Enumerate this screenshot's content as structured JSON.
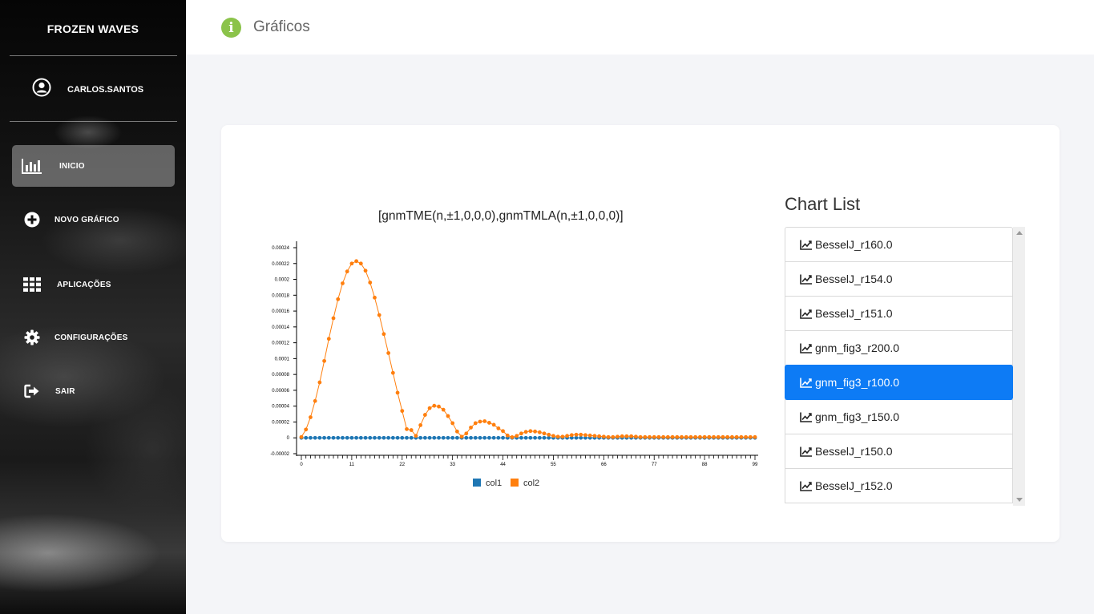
{
  "sidebar": {
    "brand": "FROZEN WAVES",
    "username": "CARLOS.SANTOS",
    "items": [
      {
        "label": "INICIO",
        "icon": "bar-chart-icon"
      },
      {
        "label": "NOVO GRÁFICO",
        "icon": "plus-circle-icon"
      },
      {
        "label": "APLICAÇÕES",
        "icon": "grid-icon"
      },
      {
        "label": "CONFIGURAÇÕES",
        "icon": "gear-icon"
      },
      {
        "label": "SAIR",
        "icon": "sign-out-icon"
      }
    ]
  },
  "header": {
    "title": "Gráficos",
    "icon": "info-icon"
  },
  "chart_list": {
    "title": "Chart List",
    "items": [
      {
        "label": "BesselJ_r160.0",
        "active": false
      },
      {
        "label": "BesselJ_r154.0",
        "active": false
      },
      {
        "label": "BesselJ_r151.0",
        "active": false
      },
      {
        "label": "gnm_fig3_r200.0",
        "active": false
      },
      {
        "label": "gnm_fig3_r100.0",
        "active": true
      },
      {
        "label": "gnm_fig3_r150.0",
        "active": false
      },
      {
        "label": "BesselJ_r150.0",
        "active": false
      },
      {
        "label": "BesselJ_r152.0",
        "active": false
      }
    ]
  },
  "colors": {
    "col1": "#1f77b4",
    "col2": "#ff7f0e",
    "active": "#0d7bf5",
    "info": "#8bc34a"
  },
  "chart_data": {
    "type": "line",
    "title": "[gnmTME(n,±1,0,0,0),gnmTMLA(n,±1,0,0,0)]",
    "xlabel": "",
    "ylabel": "",
    "xlim": [
      0,
      99
    ],
    "ylim": [
      -2e-05,
      0.00024
    ],
    "x_ticks": [
      0,
      11,
      22,
      33,
      44,
      55,
      66,
      77,
      88,
      99
    ],
    "y_ticks": [
      -2e-05,
      0,
      2e-05,
      4e-05,
      6e-05,
      8e-05,
      0.0001,
      0.00012,
      0.00014,
      0.00016,
      0.00018,
      0.0002,
      0.00022,
      0.00024
    ],
    "y_tick_labels": [
      "-0.00002",
      "0",
      "0.00002",
      "0.00004",
      "0.00006",
      "0.00008",
      "0.0001",
      "0.00012",
      "0.00014",
      "0.00016",
      "0.00018",
      "0.0002",
      "0.00022",
      "0.00024"
    ],
    "legend": "bottom",
    "series": [
      {
        "name": "col1",
        "values": [
          0,
          0,
          0,
          0,
          0,
          0,
          0,
          0,
          0,
          0,
          0,
          0,
          0,
          0,
          0,
          0,
          0,
          0,
          0,
          0,
          0,
          0,
          0,
          0,
          0,
          0,
          0,
          0,
          0,
          0,
          0,
          0,
          0,
          0,
          0,
          0,
          0,
          0,
          0,
          0,
          0,
          0,
          0,
          0,
          0,
          0,
          0,
          0,
          0,
          0,
          0,
          0,
          0,
          0,
          0,
          0,
          0,
          0,
          0,
          0,
          0,
          0,
          0,
          0,
          0,
          0,
          0,
          0,
          0,
          0,
          0,
          0,
          0,
          0,
          0,
          0,
          0,
          0,
          0,
          0,
          0,
          0,
          0,
          0,
          0,
          0,
          0,
          0,
          0,
          0,
          0,
          0,
          0,
          0,
          0,
          0,
          0,
          0,
          0,
          0
        ]
      },
      {
        "name": "col2",
        "values": [
          1e-06,
          1.05e-05,
          2.6e-05,
          4.65e-05,
          7e-05,
          9.7e-05,
          0.000125,
          0.000151,
          0.000175,
          0.000195,
          0.00021,
          0.00022,
          0.000223,
          0.00022,
          0.000211,
          0.000196,
          0.000177,
          0.000155,
          0.000131,
          0.000107,
          8.2e-05,
          5.7e-05,
          3.4e-05,
          1.1e-05,
          9.8e-06,
          2.5e-06,
          1.6e-05,
          2.9e-05,
          3.75e-05,
          4.05e-05,
          3.95e-05,
          3.55e-05,
          2.75e-05,
          1.85e-05,
          8e-06,
          1.5e-06,
          5.5e-06,
          1.3e-05,
          1.85e-05,
          2.05e-05,
          2.1e-05,
          1.9e-05,
          1.65e-05,
          1.2e-05,
          8.5e-06,
          3e-06,
          8e-07,
          2.5e-06,
          5.5e-06,
          7.5e-06,
          8.5e-06,
          8e-06,
          7e-06,
          5.5e-06,
          4e-06,
          2.5e-06,
          1.5e-06,
          1.5e-06,
          2.5e-06,
          3.5e-06,
          4e-06,
          4e-06,
          3.5e-06,
          3e-06,
          2.5e-06,
          2e-06,
          1.5e-06,
          1e-06,
          1e-06,
          1.5e-06,
          2e-06,
          2e-06,
          2e-06,
          1.5e-06,
          1e-06,
          1e-06,
          1e-06,
          1e-06,
          1e-06,
          1e-06,
          1e-06,
          1e-06,
          1e-06,
          1e-06,
          1e-06,
          1e-06,
          1e-06,
          1e-06,
          1e-06,
          1e-06,
          1e-06,
          1e-06,
          1e-06,
          1e-06,
          1e-06,
          1e-06,
          1e-06,
          1e-06,
          1e-06,
          1e-06
        ]
      }
    ]
  }
}
